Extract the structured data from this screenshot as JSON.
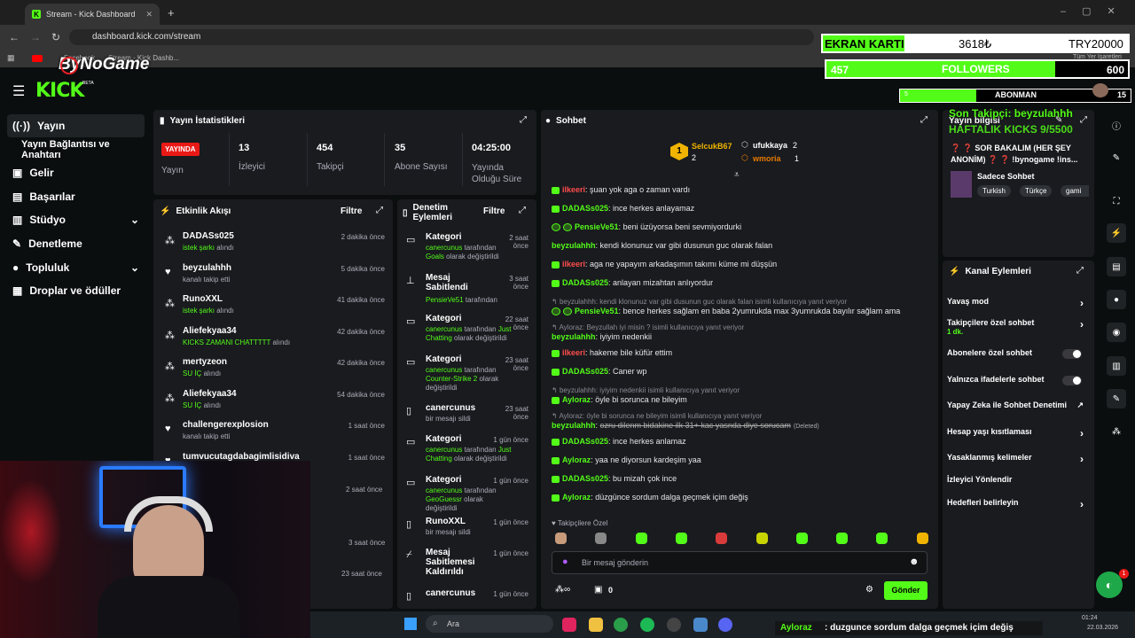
{
  "browser": {
    "tab_title": "Stream - Kick Dashboard",
    "new_tab": "+",
    "url": "dashboard.kick.com/stream",
    "bookmarks": [
      "Facebook",
      "Stream - Kick Dashb...",
      "Tüm Yer İşaretleri"
    ]
  },
  "overlay": {
    "brand": "ByNoGame",
    "gpu_label": "EKRAN KARTI",
    "gpu_price": "3618₺",
    "gpu_target": "TRY20000",
    "followers_count": "457",
    "followers_label": "FOLLOWERS",
    "followers_goal": "600",
    "followers_progress": 0.76,
    "subs_count": "5",
    "subs_label": "ABONMAN",
    "subs_goal": "15",
    "subs_progress": 0.33,
    "last_follower": "Son Takipçi: beyzulahhh",
    "weekly_kicks": "HAFTALIK KICKS 9/5500",
    "bottom_ticker_user": "Ayloraz",
    "bottom_ticker_msg": ": duzgunce sordum dalga geçmek içim değiş"
  },
  "logo": "KICK",
  "logo_tag": "BETA",
  "sidebar": [
    {
      "label": "Yayın",
      "icon": "broadcast-icon",
      "active": true
    },
    {
      "label": "Yayın Bağlantısı ve Anahtarı",
      "icon": "",
      "active": false
    },
    {
      "label": "Gelir",
      "icon": "dollar-icon",
      "active": false
    },
    {
      "label": "Başarılar",
      "icon": "trophy-icon",
      "active": false
    },
    {
      "label": "Stüdyo",
      "icon": "studio-icon",
      "active": false,
      "chevron": "⌄"
    },
    {
      "label": "Denetleme",
      "icon": "wrench-icon",
      "active": false
    },
    {
      "label": "Topluluk",
      "icon": "community-icon",
      "active": false,
      "chevron": "⌄"
    },
    {
      "label": "Droplar ve ödüller",
      "icon": "gift-icon",
      "active": false
    }
  ],
  "stats": {
    "title": "Yayın İstatistikleri",
    "live": "YAYINDA",
    "live_label": "Yayın",
    "viewers": "13",
    "viewers_label": "İzleyici",
    "followers": "454",
    "followers_label": "Takipçi",
    "subs": "35",
    "subs_label": "Abone Sayısı",
    "uptime": "04:25:00",
    "uptime_label": "Yayında Olduğu Süre"
  },
  "activity": {
    "title": "Etkinlik Akışı",
    "filter": "Filtre",
    "items": [
      {
        "name": "DADASs025",
        "sub": "istek şarkı",
        "sub_suffix": " alındı",
        "time": "2 dakika önce",
        "icon": "kicks-icon"
      },
      {
        "name": "beyzulahhh",
        "sub": "kanalı takip etti",
        "sub_suffix": "",
        "time": "5 dakika önce",
        "icon": "heart-icon"
      },
      {
        "name": "RunoXXL",
        "sub": "istek şarkı",
        "sub_suffix": " alındı",
        "time": "41 dakika önce",
        "icon": "kicks-icon"
      },
      {
        "name": "Aliefekyaa34",
        "sub": "KICKS ZAMANI CHATTTTT",
        "sub_suffix": " alındı",
        "time": "42 dakika önce",
        "icon": "kicks-icon"
      },
      {
        "name": "mertyzeon",
        "sub": "SU İÇ",
        "sub_suffix": " alındı",
        "time": "42 dakika önce",
        "icon": "kicks-icon"
      },
      {
        "name": "Aliefekyaa34",
        "sub": "SU İÇ",
        "sub_suffix": " alındı",
        "time": "54 dakika önce",
        "icon": "kicks-icon"
      },
      {
        "name": "challengerexplosion",
        "sub": "kanalı takip etti",
        "sub_suffix": "",
        "time": "1 saat önce",
        "icon": "heart-icon"
      },
      {
        "name": "tumvucutagdabagimlisidiva",
        "sub": "",
        "sub_suffix": "",
        "time": "1 saat önce",
        "icon": "heart-icon"
      }
    ],
    "hidden_times": [
      "2 saat önce",
      "3 saat önce",
      "23 saat önce"
    ]
  },
  "moderation": {
    "title": "Denetim Eylemleri",
    "filter": "Filtre",
    "items": [
      {
        "name": "Kategori",
        "line1": "canercunus",
        "line1b": " tarafından ",
        "line1c": "Goals",
        "line2": " olarak değiştirildi",
        "time": "2 saat önce",
        "icon": "category-icon"
      },
      {
        "name": "Mesaj Sabitlendi",
        "line1": "PensieVe51",
        "line1b": " tarafından",
        "line1c": "",
        "line2": "",
        "time": "3 saat önce",
        "icon": "pin-icon"
      },
      {
        "name": "Kategori",
        "line1": "canercunus",
        "line1b": " tarafından ",
        "line1c": "Just Chatting",
        "line2": " olarak değiştirildi",
        "time": "22 saat önce",
        "icon": "category-icon"
      },
      {
        "name": "Kategori",
        "line1": "canercunus",
        "line1b": " tarafından ",
        "line1c": "Counter-Strike 2",
        "line2": " olarak değiştirildi",
        "time": "23 saat önce",
        "icon": "category-icon"
      },
      {
        "name": "canercunus",
        "line1": "",
        "line1b": "bir mesajı sildi",
        "line1c": "",
        "line2": "",
        "time": "23 saat önce",
        "icon": "trash-icon"
      },
      {
        "name": "Kategori",
        "line1": "canercunus",
        "line1b": " tarafından ",
        "line1c": "Just Chatting",
        "line2": " olarak değiştirildi",
        "time": "1 gün önce",
        "icon": "category-icon"
      },
      {
        "name": "Kategori",
        "line1": "canercunus",
        "line1b": " tarafından ",
        "line1c": "GeoGuessr",
        "line2": " olarak değiştirildi",
        "time": "1 gün önce",
        "icon": "category-icon"
      },
      {
        "name": "RunoXXL",
        "line1": "",
        "line1b": "bir mesajı sildi",
        "line1c": "",
        "line2": "",
        "time": "1 gün önce",
        "icon": "trash-icon"
      },
      {
        "name": "Mesaj Sabitlemesi Kaldırıldı",
        "line1": "",
        "line1b": "",
        "line1c": "",
        "line2": "",
        "time": "1 gün önce",
        "icon": "unpin-icon"
      },
      {
        "name": "canercunus",
        "line1": "",
        "line1b": "",
        "line1c": "",
        "line2": "",
        "time": "1 gün önce",
        "icon": "trash-icon"
      }
    ]
  },
  "chat": {
    "title": "Sohbet",
    "top_gifters": [
      {
        "name": "SelcukB67",
        "count": "2",
        "rank": "1"
      },
      {
        "name": "ufukkaya",
        "count": "2"
      },
      {
        "name": "wmoria",
        "count": "1"
      }
    ],
    "messages": [
      {
        "user": "ilkeeri",
        "color": "#ff4d4d",
        "text": "şuan yok aga o zaman vardı",
        "badges": 1
      },
      {
        "user": "DADASs025",
        "color": "#53fc18",
        "text": "ince herkes anlayamaz",
        "badges": 1
      },
      {
        "user": "PensieVe51",
        "color": "#53fc18",
        "text": "beni üzüyorsa beni sevmiyordurki",
        "badges": 2
      },
      {
        "user": "beyzulahhh",
        "color": "#53fc18",
        "text": "kendi klonunuz var gibi dusunun guc olarak falan",
        "badges": 0
      },
      {
        "user": "ilkeeri",
        "color": "#ff4d4d",
        "text": "aga ne yapayım arkadaşımın takımı küme mi düşşün",
        "badges": 1
      },
      {
        "user": "DADASs025",
        "color": "#53fc18",
        "text": "anlayan mizahtan anlıyordur",
        "badges": 1
      },
      {
        "reply": "beyzulahhh: kendi klonunuz var gibi dusunun guc olarak falan isimli kullanıcıya yanıt veriyor"
      },
      {
        "user": "PensieVe51",
        "color": "#53fc18",
        "text": "bence herkes sağlam en baba 2yumrukda max 3yumrukda bayılır sağlam ama",
        "badges": 2
      },
      {
        "reply": "Ayloraz: Beyzullah iyi misin ? isimli kullanıcıya yanıt veriyor"
      },
      {
        "user": "beyzulahhh",
        "color": "#53fc18",
        "text": "iyiyim nedenkii",
        "badges": 0
      },
      {
        "user": "ilkeeri",
        "color": "#ff4d4d",
        "text": "hakeme bile küfür ettim",
        "badges": 1
      },
      {
        "user": "DADASs025",
        "color": "#53fc18",
        "text": "Caner wp",
        "badges": 1
      },
      {
        "reply": "beyzulahhh: iyiyim nedenkii isimli kullanıcıya yanıt veriyor"
      },
      {
        "user": "Ayloraz",
        "color": "#53fc18",
        "text": "öyle bi sorunca ne bileyim",
        "badges": 1
      },
      {
        "reply": "Ayloraz: öyle bi sorunca ne bileyim isimli kullanıcıya yanıt veriyor"
      },
      {
        "user": "beyzulahhh",
        "color": "#53fc18",
        "text": "ozru dilenm bidakine ilk 31+ kac yasnda diye sorucam",
        "deleted": "(Deleted)",
        "badges": 0
      },
      {
        "user": "DADASs025",
        "color": "#53fc18",
        "text": "ince herkes anlamaz",
        "badges": 1
      },
      {
        "user": "Ayloraz",
        "color": "#53fc18",
        "text": "yaa ne diyorsun kardeşim yaa",
        "badges": 1
      },
      {
        "user": "DADASs025",
        "color": "#53fc18",
        "text": "bu mizah çok ince",
        "badges": 1
      },
      {
        "user": "Ayloraz",
        "color": "#53fc18",
        "text": "düzgünce sordum dalga geçmek içim değiş",
        "badges": 1
      }
    ],
    "emote_label": "Takipçilere Özel",
    "placeholder": "Bir mesaj gönderin",
    "points": "0",
    "send": "Gönder"
  },
  "stream_info": {
    "title": "Yayın bilgisi",
    "stream_title": "❓ ❓ SOR BAKALIM (HER ŞEY ANONİM) ❓ ❓ !bynogame !ins...",
    "category": "Sadece Sohbet",
    "tags": [
      "Turkish",
      "Türkçe",
      "gami"
    ]
  },
  "channel_actions": {
    "title": "Kanal Eylemleri",
    "items": [
      {
        "label": "Yavaş mod",
        "kind": "arrow"
      },
      {
        "label": "Takipçilere özel sohbet",
        "sub": "1 dk.",
        "kind": "arrow"
      },
      {
        "label": "Abonelere özel sohbet",
        "kind": "toggle"
      },
      {
        "label": "Yalnızca ifadelerle sohbet",
        "kind": "toggle"
      },
      {
        "label": "Yapay Zeka ile Sohbet Denetimi",
        "kind": "external"
      },
      {
        "label": "Hesap yaşı kısıtlaması",
        "kind": "arrow"
      },
      {
        "label": "Yasaklanmış kelimeler",
        "kind": "arrow"
      },
      {
        "label": "İzleyici Yönlendir",
        "kind": "none"
      },
      {
        "label": "Hedefleri belirleyin",
        "kind": "arrow"
      }
    ]
  },
  "taskbar": {
    "search": "Ara",
    "time": "01:24",
    "date": "22.03.2026",
    "notif_count": "1"
  }
}
